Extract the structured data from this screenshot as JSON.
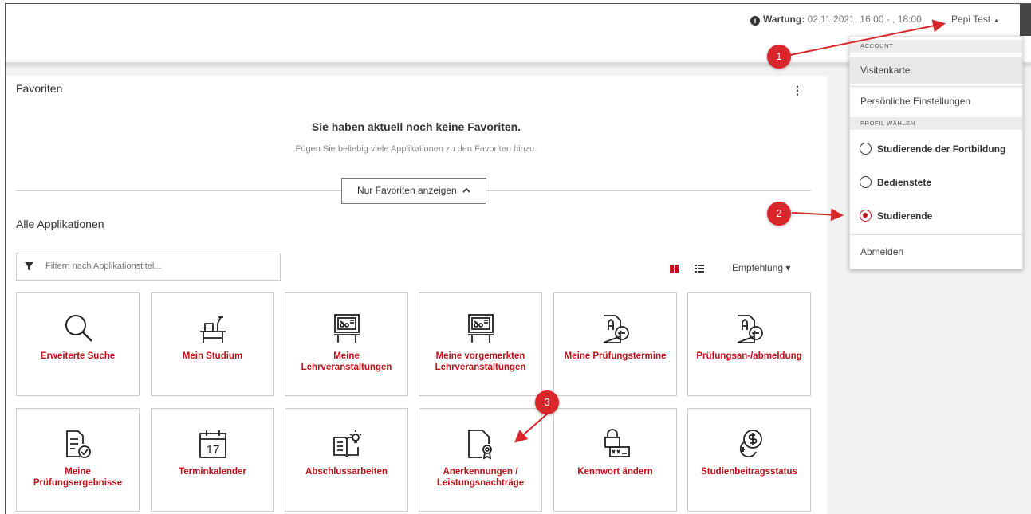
{
  "topbar": {
    "maintenance_label": "Wartung:",
    "maintenance_value": "02.11.2021, 16:00 - , 18:00",
    "user_name": "Pepi Test",
    "user_caret": "▲"
  },
  "favorites": {
    "title": "Favoriten",
    "menu_icon": "⋮",
    "empty_heading": "Sie haben aktuell noch keine Favoriten.",
    "empty_hint": "Fügen Sie beliebig viele Applikationen zu den Favoriten hinzu.",
    "toggle_label": "Nur Favoriten anzeigen",
    "toggle_caret": "⌃"
  },
  "apps": {
    "title": "Alle Applikationen",
    "filter_placeholder": "Filtern nach Applikationstitel...",
    "sort_label": "Empfehlung",
    "sort_caret": "▾",
    "tiles": [
      {
        "label": "Erweiterte Suche",
        "icon": "search-icon"
      },
      {
        "label": "Mein Studium",
        "icon": "desk-icon"
      },
      {
        "label": "Meine Lehrveranstaltungen",
        "icon": "lecture-board-icon"
      },
      {
        "label": "Meine vorgemerkten Lehrveranstaltungen",
        "icon": "lecture-board-icon"
      },
      {
        "label": "Meine Prüfungstermine",
        "icon": "exam-document-icon"
      },
      {
        "label": "Prüfungsan-/abmeldung",
        "icon": "exam-document-icon"
      },
      {
        "label": "Meine Prüfungsergebnisse",
        "icon": "result-checklist-icon"
      },
      {
        "label": "Terminkalender",
        "icon": "calendar-icon"
      },
      {
        "label": "Abschlussarbeiten",
        "icon": "thesis-book-icon"
      },
      {
        "label": "Anerkennungen / Leistungsnachträge",
        "icon": "certificate-icon"
      },
      {
        "label": "Kennwort ändern",
        "icon": "password-lock-icon"
      },
      {
        "label": "Studienbeitragsstatus",
        "icon": "coins-icon"
      }
    ],
    "calendar_day": "17"
  },
  "user_menu": {
    "section_account": "ACCOUNT",
    "business_card": "Visitenkarte",
    "personal_settings": "Persönliche Einstellungen",
    "section_profile": "PROFIL WÄHLEN",
    "profiles": [
      {
        "label": "Studierende der Fortbildung",
        "selected": false
      },
      {
        "label": "Bedienstete",
        "selected": false
      },
      {
        "label": "Studierende",
        "selected": true
      }
    ],
    "logout": "Abmelden"
  },
  "annotations": {
    "step1": "1",
    "step2": "2",
    "step3": "3"
  },
  "colors": {
    "accent": "#c0101a",
    "badge": "#d8262b"
  }
}
